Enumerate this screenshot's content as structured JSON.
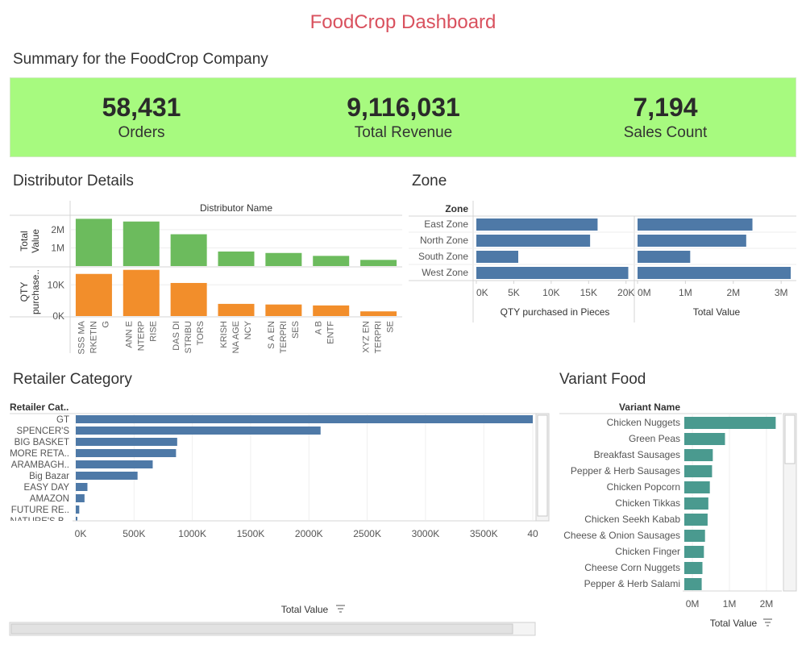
{
  "page_title": "FoodCrop Dashboard",
  "summary": {
    "title": "Summary for the FoodCrop Company",
    "kpis": [
      {
        "value": "58,431",
        "label": "Orders"
      },
      {
        "value": "9,116,031",
        "label": "Total Revenue"
      },
      {
        "value": "7,194",
        "label": "Sales Count"
      }
    ]
  },
  "sections": {
    "distributor": "Distributor Details",
    "zone": "Zone",
    "retailer": "Retailer Category",
    "variant": "Variant Food"
  },
  "colors": {
    "title": "#d9515e",
    "kpi_band": "#a7fa7f",
    "green_bar": "#6cbb5d",
    "orange_bar": "#f28e2b",
    "blue_bar": "#4e79a7",
    "teal_bar": "#4a9a8f"
  },
  "chart_data": [
    {
      "id": "distributor",
      "type": "bar",
      "column_header": "Distributor Name",
      "categories": [
        "SSS MARKETING",
        "ANNE NTERPRISE",
        "DAS DISTRIBUTORS",
        "KRISHNA AGENCY",
        "S A ENTERPRISES",
        "A B ENTF",
        "XYZ ENTERPRISE"
      ],
      "tick_labels": [
        [
          "SSS MA",
          "RKETIN",
          "G"
        ],
        [
          "ANN E",
          "NTERP",
          "RISE"
        ],
        [
          "DAS DI",
          "STRIBU",
          "TORS"
        ],
        [
          "KRISH",
          "NA AGE",
          "NCY"
        ],
        [
          "S A EN",
          "TERPRI",
          "SES"
        ],
        [
          "A B",
          "ENTF"
        ],
        [
          "XYZ EN",
          "TERPRI",
          "SE"
        ]
      ],
      "series": [
        {
          "name": "Total Value",
          "axis_label": [
            "Total",
            "Value"
          ],
          "values": [
            2600000,
            2450000,
            1750000,
            800000,
            720000,
            560000,
            340000
          ],
          "ticks": [
            {
              "v": 1000000,
              "label": "1M"
            },
            {
              "v": 2000000,
              "label": "2M"
            }
          ],
          "ylim": [
            0,
            2750000
          ]
        },
        {
          "name": "QTY purchased",
          "axis_label": [
            "QTY",
            "purchase.."
          ],
          "values": [
            13500,
            14800,
            10600,
            3900,
            3700,
            3400,
            1500
          ],
          "ticks": [
            {
              "v": 0,
              "label": "0K"
            },
            {
              "v": 10000,
              "label": "10K"
            }
          ],
          "ylim": [
            0,
            15500
          ]
        }
      ]
    },
    {
      "id": "zone",
      "type": "bar",
      "orientation": "horizontal",
      "row_header": "Zone",
      "categories": [
        "East Zone",
        "North Zone",
        "South Zone",
        "West Zone"
      ],
      "series": [
        {
          "name": "QTY purchased in Pieces",
          "values": [
            16200,
            15200,
            5600,
            20300
          ],
          "xlim": [
            0,
            21000
          ],
          "ticks": [
            {
              "v": 0,
              "label": "0K"
            },
            {
              "v": 5000,
              "label": "5K"
            },
            {
              "v": 10000,
              "label": "10K"
            },
            {
              "v": 15000,
              "label": "15K"
            },
            {
              "v": 20000,
              "label": "20K"
            }
          ]
        },
        {
          "name": "Total Value",
          "values": [
            2400000,
            2270000,
            1100000,
            3200000
          ],
          "xlim": [
            0,
            3300000
          ],
          "ticks": [
            {
              "v": 0,
              "label": "0M"
            },
            {
              "v": 1000000,
              "label": "1M"
            },
            {
              "v": 2000000,
              "label": "2M"
            },
            {
              "v": 3000000,
              "label": "3M"
            }
          ]
        }
      ]
    },
    {
      "id": "retailer",
      "type": "bar",
      "orientation": "horizontal",
      "row_header": "Retailer Cat..",
      "xlabel": "Total Value",
      "categories": [
        "GT",
        "SPENCER'S",
        "BIG BASKET",
        "MORE RETA..",
        "ARAMBAGH..",
        "Big Bazar",
        "EASY DAY",
        "AMAZON",
        "FUTURE RE..",
        "NATURE'S B.."
      ],
      "values": [
        3920000,
        2100000,
        870000,
        860000,
        660000,
        530000,
        100000,
        75000,
        30000,
        12000
      ],
      "xlim": [
        -60000,
        3920000
      ],
      "ticks": [
        {
          "v": 0,
          "label": "0K"
        },
        {
          "v": 500000,
          "label": "500K"
        },
        {
          "v": 1000000,
          "label": "1000K"
        },
        {
          "v": 1500000,
          "label": "1500K"
        },
        {
          "v": 2000000,
          "label": "2000K"
        },
        {
          "v": 2500000,
          "label": "2500K"
        },
        {
          "v": 3000000,
          "label": "3000K"
        },
        {
          "v": 3500000,
          "label": "3500K"
        },
        {
          "v": 3920000,
          "label": "40"
        }
      ]
    },
    {
      "id": "variant",
      "type": "bar",
      "orientation": "horizontal",
      "row_header": "Variant Name",
      "xlabel": "Total Value",
      "categories": [
        "Chicken Nuggets",
        "Green Peas",
        "Breakfast Sausages",
        "Pepper & Herb Sausages",
        "Chicken Popcorn",
        "Chicken Tikkas",
        "Chicken Seekh Kabab",
        "Cheese & Onion Sausages",
        "Chicken Finger",
        "Cheese Corn Nuggets",
        "Pepper & Herb Salami"
      ],
      "values": [
        2250000,
        880000,
        550000,
        530000,
        470000,
        430000,
        410000,
        340000,
        310000,
        270000,
        250000
      ],
      "xlim": [
        -220000,
        2350000
      ],
      "ticks": [
        {
          "v": 0,
          "label": "0M"
        },
        {
          "v": 1000000,
          "label": "1M"
        },
        {
          "v": 2000000,
          "label": "2M"
        }
      ]
    }
  ]
}
